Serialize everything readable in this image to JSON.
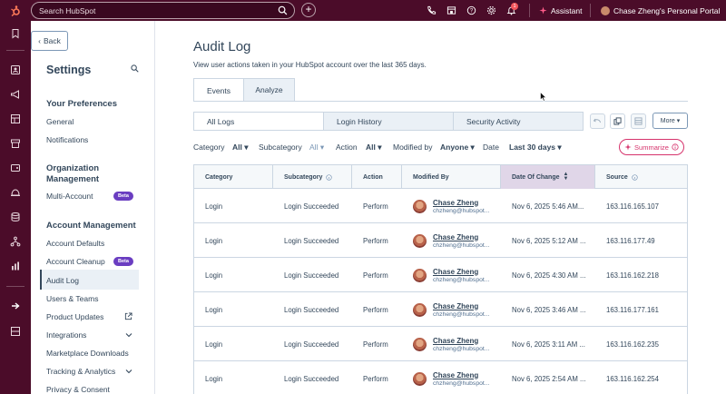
{
  "topbar": {
    "search_placeholder": "Search HubSpot",
    "plus_label": "+",
    "notification_count": "1",
    "assistant_label": "Assistant",
    "portal_label": "Chase Zheng's Personal Portal",
    "accent": "#4b0c29"
  },
  "sidebar": {
    "back_label": "Back",
    "title": "Settings",
    "sections": {
      "preferences": "Your Preferences",
      "org": "Organization Management",
      "account": "Account Management"
    },
    "items": {
      "general": "General",
      "notifications": "Notifications",
      "multi_account": "Multi-Account",
      "account_defaults": "Account Defaults",
      "account_cleanup": "Account Cleanup",
      "audit_log": "Audit Log",
      "users_teams": "Users & Teams",
      "product_updates": "Product Updates",
      "integrations": "Integrations",
      "marketplace": "Marketplace Downloads",
      "tracking": "Tracking & Analytics",
      "privacy": "Privacy & Consent"
    },
    "beta_label": "Beta"
  },
  "main": {
    "title": "Audit Log",
    "description": "View user actions taken in your HubSpot account over the last 365 days.",
    "tabs": [
      "Events",
      "Analyze"
    ],
    "segments": [
      "All Logs",
      "Login History",
      "Security Activity"
    ],
    "more_label": "More",
    "filters": {
      "category_label": "Category",
      "category_value": "All",
      "subcategory_label": "Subcategory",
      "subcategory_value": "All",
      "action_label": "Action",
      "action_value": "All",
      "modified_label": "Modified by",
      "modified_value": "Anyone",
      "date_label": "Date",
      "date_value": "Last 30 days"
    },
    "summarize_label": "Summarize"
  },
  "table": {
    "columns": [
      "Category",
      "Subcategory",
      "Action",
      "Modified By",
      "Date Of Change",
      "Source"
    ],
    "rows": [
      {
        "category": "Login",
        "subcategory": "Login Succeeded",
        "action": "Perform",
        "name": "Chase Zheng",
        "email": "chzheng@hubspot...",
        "date": "Nov 6, 2025 5:46 AM...",
        "source": "163.116.165.107"
      },
      {
        "category": "Login",
        "subcategory": "Login Succeeded",
        "action": "Perform",
        "name": "Chase Zheng",
        "email": "chzheng@hubspot...",
        "date": "Nov 6, 2025 5:12 AM ...",
        "source": "163.116.177.49"
      },
      {
        "category": "Login",
        "subcategory": "Login Succeeded",
        "action": "Perform",
        "name": "Chase Zheng",
        "email": "chzheng@hubspot...",
        "date": "Nov 6, 2025 4:30 AM ...",
        "source": "163.116.162.218"
      },
      {
        "category": "Login",
        "subcategory": "Login Succeeded",
        "action": "Perform",
        "name": "Chase Zheng",
        "email": "chzheng@hubspot...",
        "date": "Nov 6, 2025 3:46 AM ...",
        "source": "163.116.177.161"
      },
      {
        "category": "Login",
        "subcategory": "Login Succeeded",
        "action": "Perform",
        "name": "Chase Zheng",
        "email": "chzheng@hubspot...",
        "date": "Nov 6, 2025 3:11 AM ...",
        "source": "163.116.162.235"
      },
      {
        "category": "Login",
        "subcategory": "Login Succeeded",
        "action": "Perform",
        "name": "Chase Zheng",
        "email": "chzheng@hubspot...",
        "date": "Nov 6, 2025 2:54 AM ...",
        "source": "163.116.162.254"
      }
    ]
  }
}
